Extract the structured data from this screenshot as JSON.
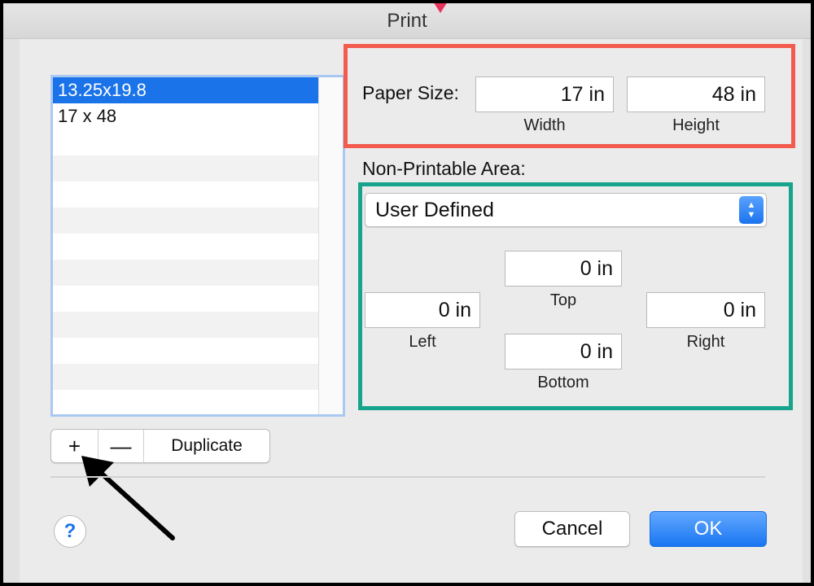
{
  "window": {
    "title": "Print"
  },
  "paper_sizes": {
    "items": [
      "13.25x19.8",
      "17 x 48"
    ],
    "selected_index": 0
  },
  "list_controls": {
    "add_label": "+",
    "remove_label": "—",
    "duplicate_label": "Duplicate"
  },
  "paper_size": {
    "label": "Paper Size:",
    "width_value": "17 in",
    "width_caption": "Width",
    "height_value": "48 in",
    "height_caption": "Height"
  },
  "non_printable": {
    "label": "Non-Printable Area:",
    "preset_selected": "User Defined",
    "top_value": "0 in",
    "top_caption": "Top",
    "left_value": "0 in",
    "left_caption": "Left",
    "right_value": "0 in",
    "right_caption": "Right",
    "bottom_value": "0 in",
    "bottom_caption": "Bottom"
  },
  "footer": {
    "help_label": "?",
    "cancel_label": "Cancel",
    "ok_label": "OK"
  },
  "colors": {
    "accent": "#1a73e8",
    "highlight_red": "#f25b4e",
    "highlight_green": "#16a58c"
  },
  "icons": {
    "annotation_arrow": "arrow-pointing-to-add-button",
    "select_stepper": "up-down-chevron-icon",
    "help": "question-mark-icon"
  }
}
